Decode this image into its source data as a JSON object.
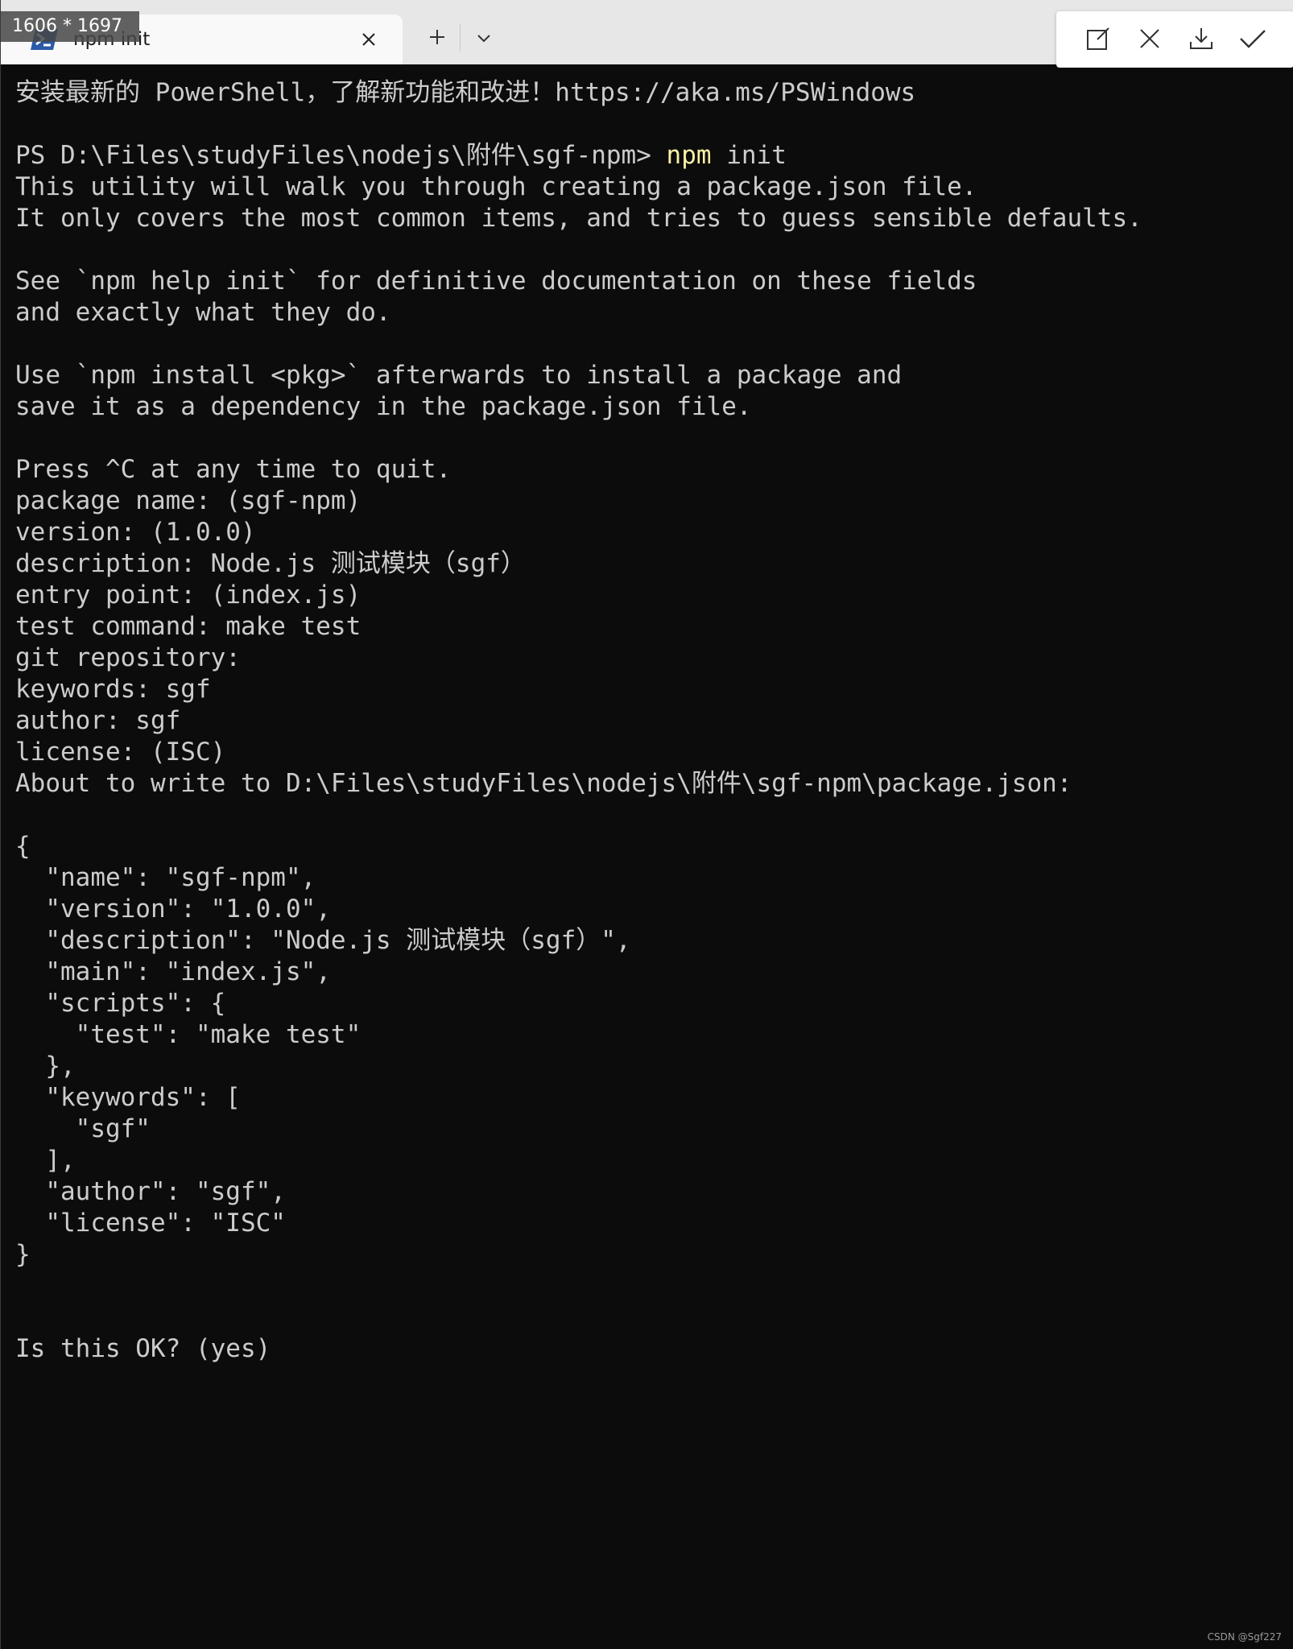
{
  "overlay": {
    "size_label": "1606 * 1697"
  },
  "tab": {
    "title": "npm init",
    "icon": "powershell-icon",
    "close_icon": "close-icon"
  },
  "tabbar": {
    "new_tab_icon": "plus-icon",
    "dropdown_icon": "chevron-down-icon"
  },
  "toolbar": {
    "buttons": [
      "edit-icon",
      "close-icon",
      "download-icon",
      "check-icon"
    ]
  },
  "terminal": {
    "lines": [
      "安装最新的 PowerShell，了解新功能和改进！https://aka.ms/PSWindows",
      "",
      {
        "prompt": "PS D:\\Files\\studyFiles\\nodejs\\附件\\sgf-npm> ",
        "command": "npm",
        "args": " init"
      },
      "This utility will walk you through creating a package.json file.",
      "It only covers the most common items, and tries to guess sensible defaults.",
      "",
      "See `npm help init` for definitive documentation on these fields",
      "and exactly what they do.",
      "",
      "Use `npm install <pkg>` afterwards to install a package and",
      "save it as a dependency in the package.json file.",
      "",
      "Press ^C at any time to quit.",
      "package name: (sgf-npm)",
      "version: (1.0.0)",
      "description: Node.js 测试模块（sgf）",
      "entry point: (index.js)",
      "test command: make test",
      "git repository:",
      "keywords: sgf",
      "author: sgf",
      "license: (ISC)",
      "About to write to D:\\Files\\studyFiles\\nodejs\\附件\\sgf-npm\\package.json:",
      "",
      "{",
      "  \"name\": \"sgf-npm\",",
      "  \"version\": \"1.0.0\",",
      "  \"description\": \"Node.js 测试模块（sgf）\",",
      "  \"main\": \"index.js\",",
      "  \"scripts\": {",
      "    \"test\": \"make test\"",
      "  },",
      "  \"keywords\": [",
      "    \"sgf\"",
      "  ],",
      "  \"author\": \"sgf\",",
      "  \"license\": \"ISC\"",
      "}",
      "",
      "",
      "Is this OK? (yes)"
    ]
  },
  "watermark": "CSDN @Sgf227",
  "colors": {
    "terminal_bg": "#0c0c0c",
    "terminal_fg": "#cccccc",
    "command_highlight": "#f9f1a5",
    "titlebar_bg": "#e7e7e7",
    "tab_bg": "#f9f9f9"
  }
}
